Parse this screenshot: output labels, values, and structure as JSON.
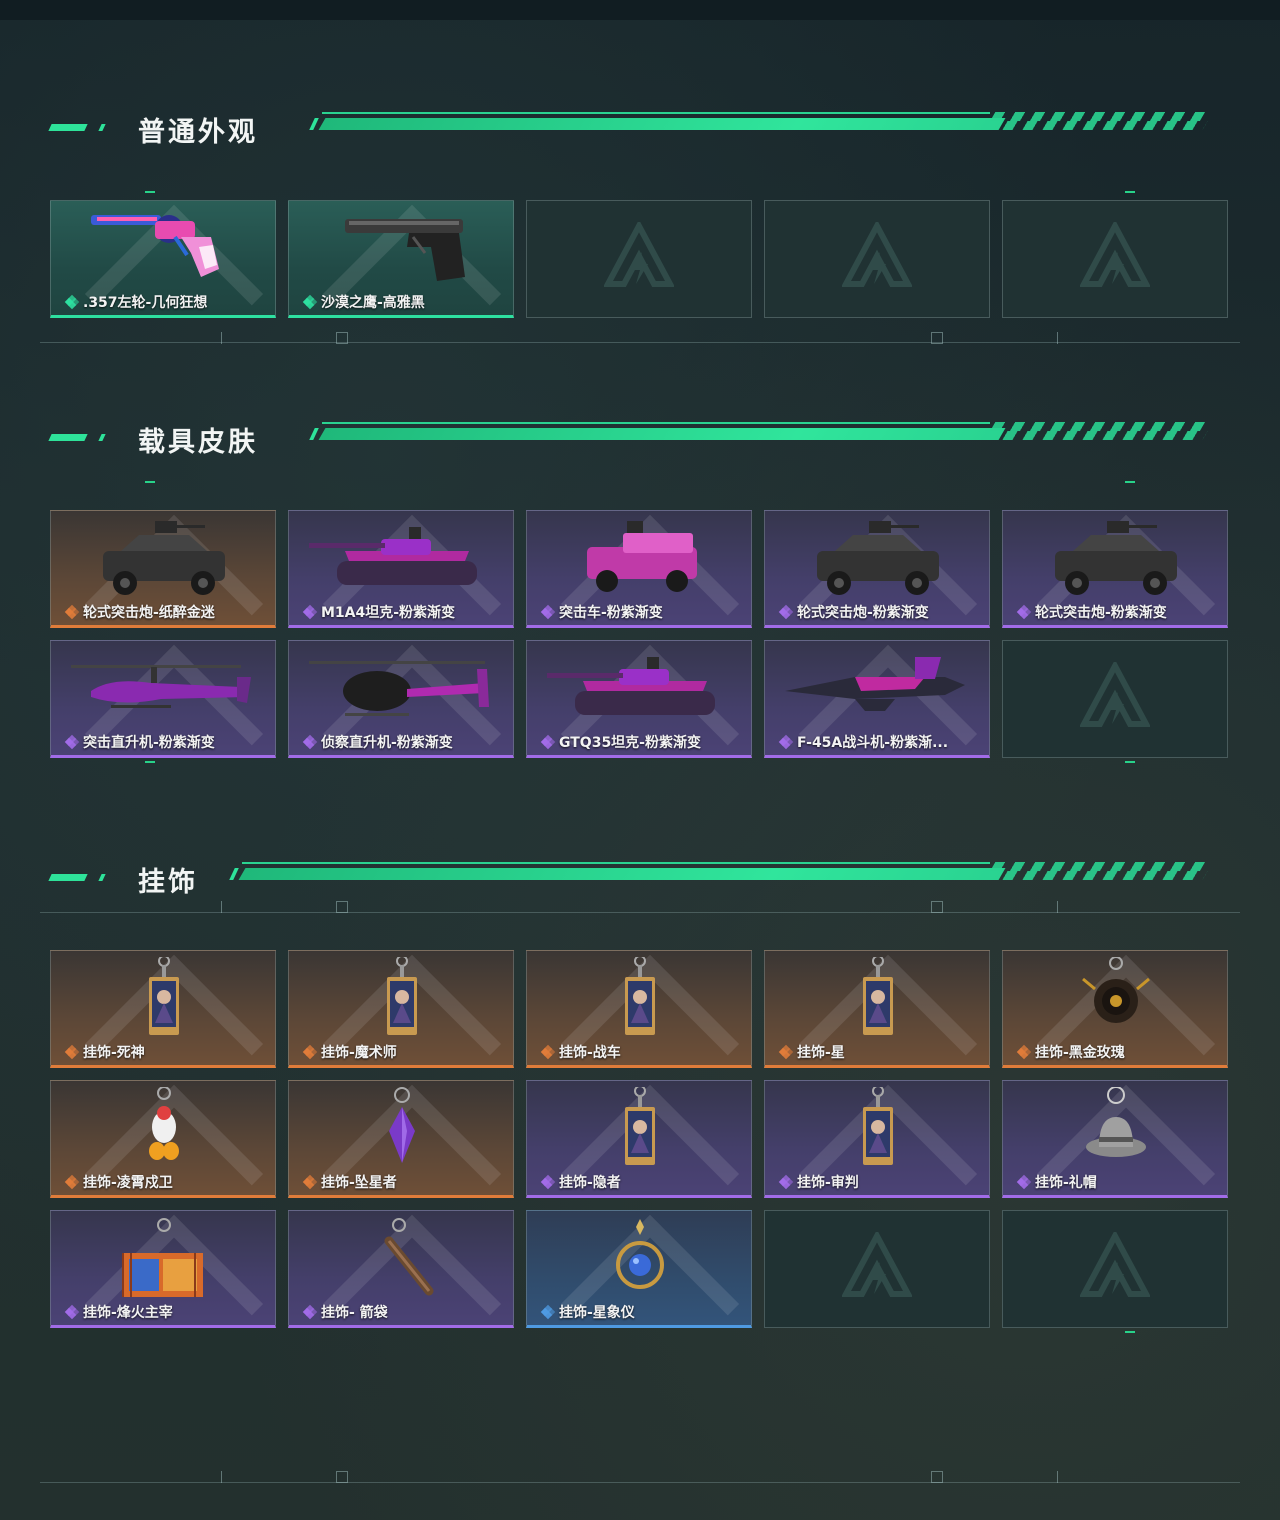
{
  "colors": {
    "accent": "#2ee39a",
    "orange": "#e07c3a",
    "purple": "#a26ce8",
    "blue": "#4f9ae2",
    "green": "#2ee0a0"
  },
  "sections": [
    {
      "title": "普通外观",
      "items": [
        {
          "name": ".357左轮-几何狂想",
          "rarity": "green",
          "icon": "revolver-icon"
        },
        {
          "name": "沙漠之鹰-高雅黑",
          "rarity": "green",
          "icon": "pistol-icon"
        },
        {
          "name": "",
          "rarity": "empty"
        },
        {
          "name": "",
          "rarity": "empty"
        },
        {
          "name": "",
          "rarity": "empty"
        }
      ]
    },
    {
      "title": "载具皮肤",
      "items": [
        {
          "name": "轮式突击炮-纸醉金迷",
          "rarity": "orange",
          "icon": "armored-car-icon"
        },
        {
          "name": "M1A4坦克-粉紫渐变",
          "rarity": "purple",
          "icon": "tank-icon"
        },
        {
          "name": "突击车-粉紫渐变",
          "rarity": "purple",
          "icon": "assault-car-icon"
        },
        {
          "name": "轮式突击炮-粉紫渐变",
          "rarity": "purple",
          "icon": "armored-car-icon"
        },
        {
          "name": "轮式突击炮-粉紫渐变",
          "rarity": "purple",
          "icon": "armored-car-icon"
        },
        {
          "name": "突击直升机-粉紫渐变",
          "rarity": "purple",
          "icon": "attack-helicopter-icon"
        },
        {
          "name": "侦察直升机-粉紫渐变",
          "rarity": "purple",
          "icon": "scout-helicopter-icon"
        },
        {
          "name": "GTQ35坦克-粉紫渐变",
          "rarity": "purple",
          "icon": "tank-icon"
        },
        {
          "name": "F-45A战斗机-粉紫渐...",
          "rarity": "purple",
          "icon": "fighter-jet-icon"
        },
        {
          "name": "",
          "rarity": "empty"
        }
      ]
    },
    {
      "title": "挂饰",
      "items": [
        {
          "name": "挂饰-死神",
          "rarity": "orange",
          "icon": "tarot-charm-icon"
        },
        {
          "name": "挂饰-魔术师",
          "rarity": "orange",
          "icon": "tarot-charm-icon"
        },
        {
          "name": "挂饰-战车",
          "rarity": "orange",
          "icon": "tarot-charm-icon"
        },
        {
          "name": "挂饰-星",
          "rarity": "orange",
          "icon": "tarot-charm-icon"
        },
        {
          "name": "挂饰-黑金玫瑰",
          "rarity": "orange",
          "icon": "rose-charm-icon"
        },
        {
          "name": "挂饰-凌霄戍卫",
          "rarity": "orange",
          "icon": "figure-charm-icon"
        },
        {
          "name": "挂饰-坠星者",
          "rarity": "orange",
          "icon": "crystal-charm-icon"
        },
        {
          "name": "挂饰-隐者",
          "rarity": "purple",
          "icon": "tarot-charm-icon"
        },
        {
          "name": "挂饰-审判",
          "rarity": "purple",
          "icon": "tarot-charm-icon"
        },
        {
          "name": "挂饰-礼帽",
          "rarity": "purple",
          "icon": "hat-charm-icon"
        },
        {
          "name": "挂饰-烽火主宰",
          "rarity": "purple",
          "icon": "container-charm-icon"
        },
        {
          "name": "挂饰- 箭袋",
          "rarity": "purple",
          "icon": "quiver-charm-icon"
        },
        {
          "name": "挂饰-星象仪",
          "rarity": "blue",
          "icon": "astrolabe-charm-icon"
        },
        {
          "name": "",
          "rarity": "empty"
        },
        {
          "name": "",
          "rarity": "empty"
        }
      ]
    }
  ]
}
